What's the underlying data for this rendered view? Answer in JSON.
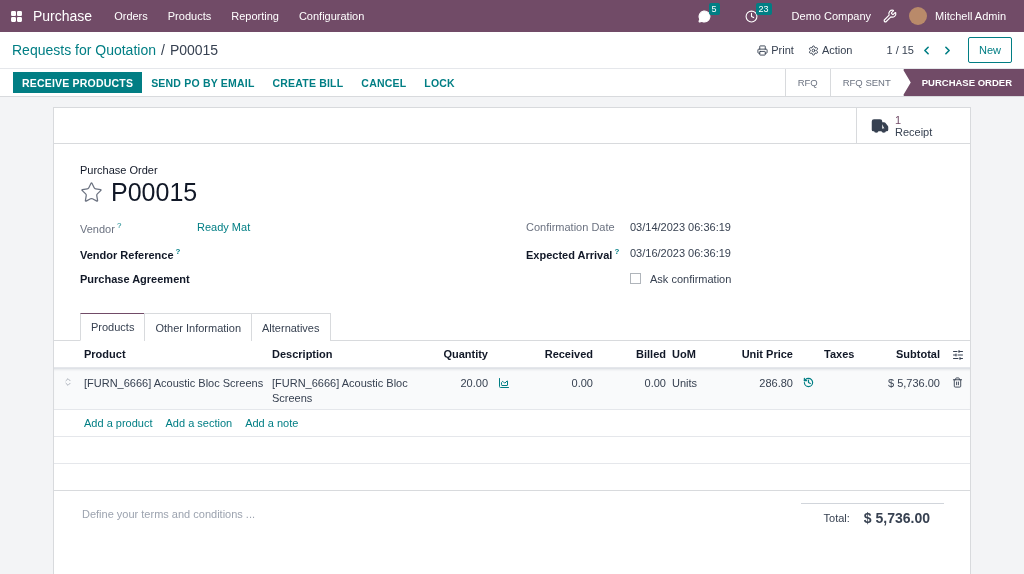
{
  "navbar": {
    "app": "Purchase",
    "menus": [
      "Orders",
      "Products",
      "Reporting",
      "Configuration"
    ],
    "messages_count": "5",
    "activities_count": "23",
    "company": "Demo Company",
    "user": "Mitchell Admin"
  },
  "breadcrumb": {
    "parent": "Requests for Quotation",
    "separator": "/",
    "current": "P00015"
  },
  "actions": {
    "print": "Print",
    "action": "Action",
    "pager": "1 / 15",
    "new": "New"
  },
  "buttons": [
    {
      "label": "RECEIVE PRODUCTS",
      "primary": true
    },
    {
      "label": "SEND PO BY EMAIL",
      "primary": false
    },
    {
      "label": "CREATE BILL",
      "primary": false
    },
    {
      "label": "CANCEL",
      "primary": false
    },
    {
      "label": "LOCK",
      "primary": false
    }
  ],
  "stages": [
    {
      "label": "RFQ",
      "selected": false
    },
    {
      "label": "RFQ SENT",
      "selected": false
    },
    {
      "label": "PURCHASE ORDER",
      "selected": true
    }
  ],
  "smart_button": {
    "count": "1",
    "label": "Receipt"
  },
  "record": {
    "type_label": "Purchase Order",
    "name": "P00015",
    "favorite": false
  },
  "fields_left": [
    {
      "label": "Vendor",
      "help": "?",
      "readonly": true,
      "value": "Ready Mat"
    },
    {
      "label": "Vendor Reference",
      "help": "?",
      "readonly": false
    },
    {
      "label": "Purchase Agreement",
      "readonly": false
    }
  ],
  "fields_right": [
    {
      "label": "Confirmation Date",
      "readonly": true,
      "value": "03/14/2023 06:36:19"
    },
    {
      "label": "Expected Arrival",
      "help": "?",
      "readonly": false,
      "value": "03/16/2023 06:36:19"
    }
  ],
  "ask_confirmation": {
    "label": "Ask confirmation",
    "checked": false
  },
  "tabs": [
    {
      "label": "Products",
      "selected": true
    },
    {
      "label": "Other Information",
      "selected": false
    },
    {
      "label": "Alternatives",
      "selected": false
    }
  ],
  "table": {
    "columns": [
      "Product",
      "Description",
      "Quantity",
      "Received",
      "Billed",
      "UoM",
      "Unit Price",
      "Taxes",
      "Subtotal"
    ],
    "rows": [
      {
        "product": "[FURN_6666] Acoustic Bloc Screens",
        "description": "[FURN_6666] Acoustic Bloc Screens",
        "quantity": "20.00",
        "received": "0.00",
        "billed": "0.00",
        "uom": "Units",
        "unit_price": "286.80",
        "subtotal": "$ 5,736.00"
      }
    ]
  },
  "add_links": [
    "Add a product",
    "Add a section",
    "Add a note"
  ],
  "terms": {
    "placeholder": "Define your terms and conditions ..."
  },
  "total": {
    "label": "Total:",
    "amount": "$ 5,736.00"
  }
}
